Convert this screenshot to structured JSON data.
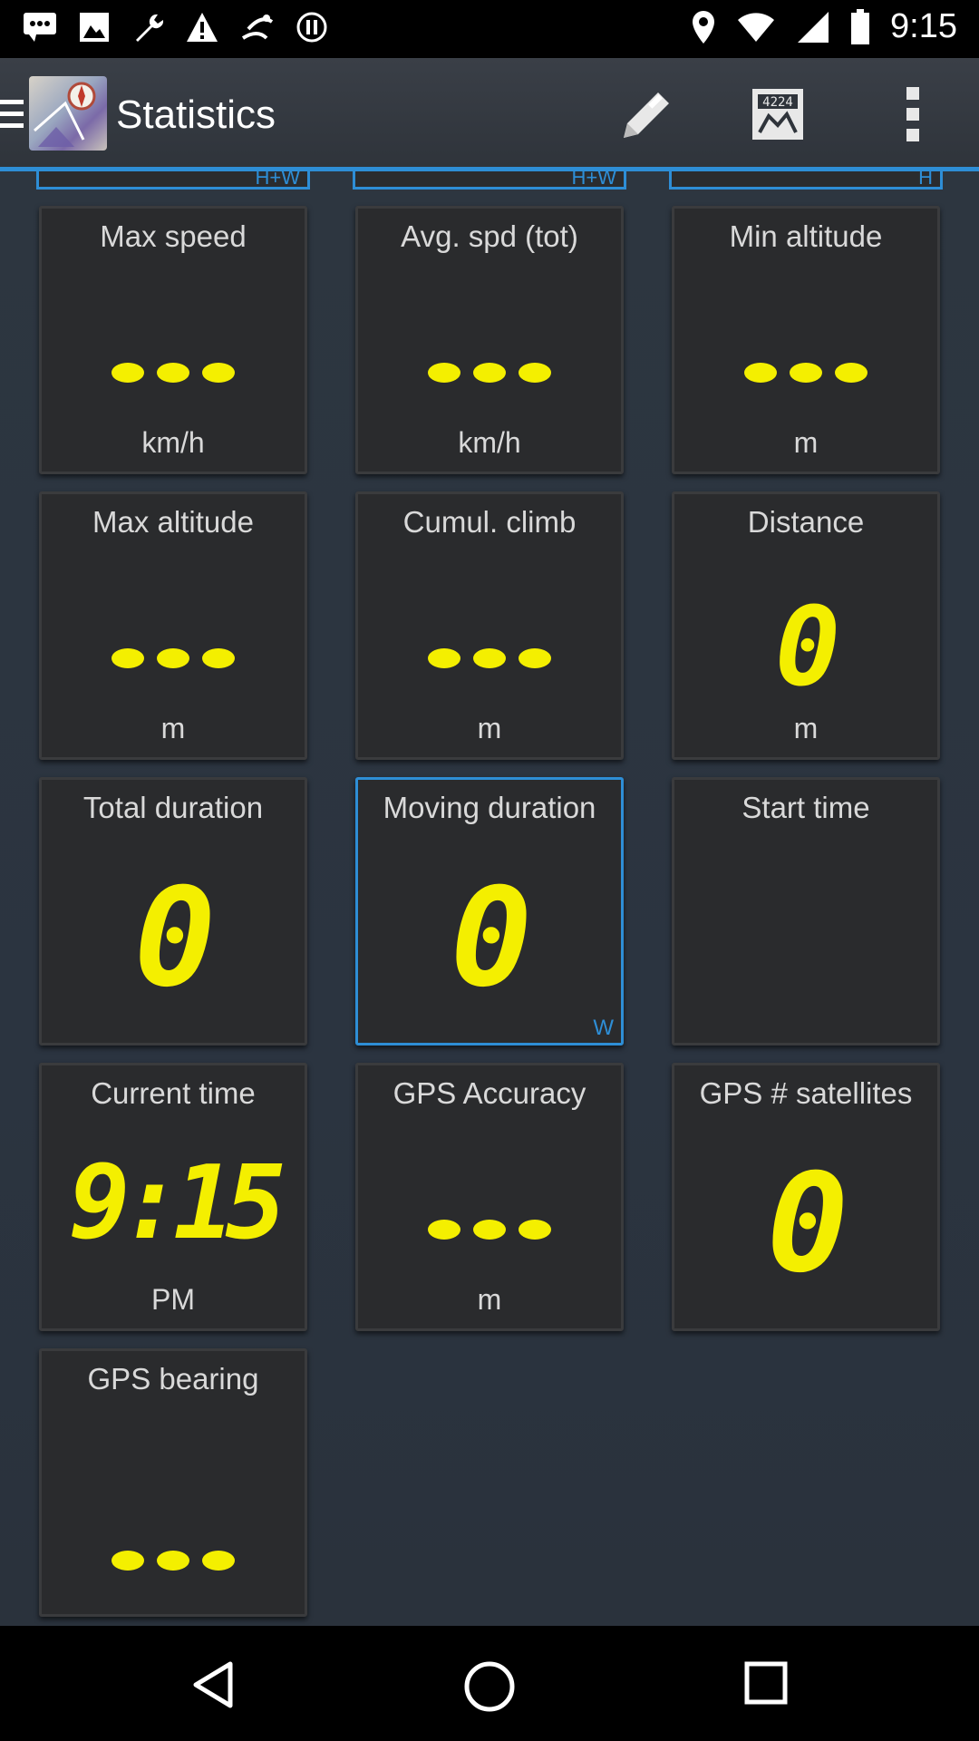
{
  "status_bar": {
    "time": "9:15",
    "left_icons": [
      "message-icon",
      "image-icon",
      "wrench-icon",
      "warning-icon",
      "satellite-icon",
      "data-icon"
    ],
    "right_icons": [
      "location-pin-icon",
      "wifi-icon",
      "signal-icon",
      "battery-icon"
    ]
  },
  "app_bar": {
    "title": "Statistics",
    "actions": [
      "edit-pencil-icon",
      "calculator-display-icon",
      "overflow-menu-icon"
    ]
  },
  "top_strip": [
    {
      "tag": "H+W"
    },
    {
      "tag": "H+W"
    },
    {
      "tag": "H"
    }
  ],
  "tiles": [
    {
      "label": "Max speed",
      "value": "",
      "unit": "km/h",
      "corner": ""
    },
    {
      "label": "Avg. spd (tot)",
      "value": "",
      "unit": "km/h",
      "corner": ""
    },
    {
      "label": "Min altitude",
      "value": "",
      "unit": "m",
      "corner": ""
    },
    {
      "label": "Max altitude",
      "value": "",
      "unit": "m",
      "corner": ""
    },
    {
      "label": "Cumul. climb",
      "value": "",
      "unit": "m",
      "corner": ""
    },
    {
      "label": "Distance",
      "value": "0",
      "unit": "m",
      "corner": ""
    },
    {
      "label": "Total duration",
      "value": "0",
      "unit": "",
      "corner": ""
    },
    {
      "label": "Moving duration",
      "value": "0",
      "unit": "",
      "corner": "W"
    },
    {
      "label": "Start time",
      "value": "",
      "unit": "",
      "corner": ""
    },
    {
      "label": "Current time",
      "value": "9:15",
      "unit": "PM",
      "corner": ""
    },
    {
      "label": "GPS Accuracy",
      "value": "",
      "unit": "m",
      "corner": ""
    },
    {
      "label": "GPS # satellites",
      "value": "0",
      "unit": "",
      "corner": ""
    },
    {
      "label": "GPS bearing",
      "value": "",
      "unit": "",
      "corner": ""
    }
  ],
  "colors": {
    "accent": "#2e8ed6",
    "value_yellow": "#f4ef00",
    "tile_bg": "#2a2b2d"
  },
  "nav_bar": [
    "back-icon",
    "home-icon",
    "recents-icon"
  ]
}
